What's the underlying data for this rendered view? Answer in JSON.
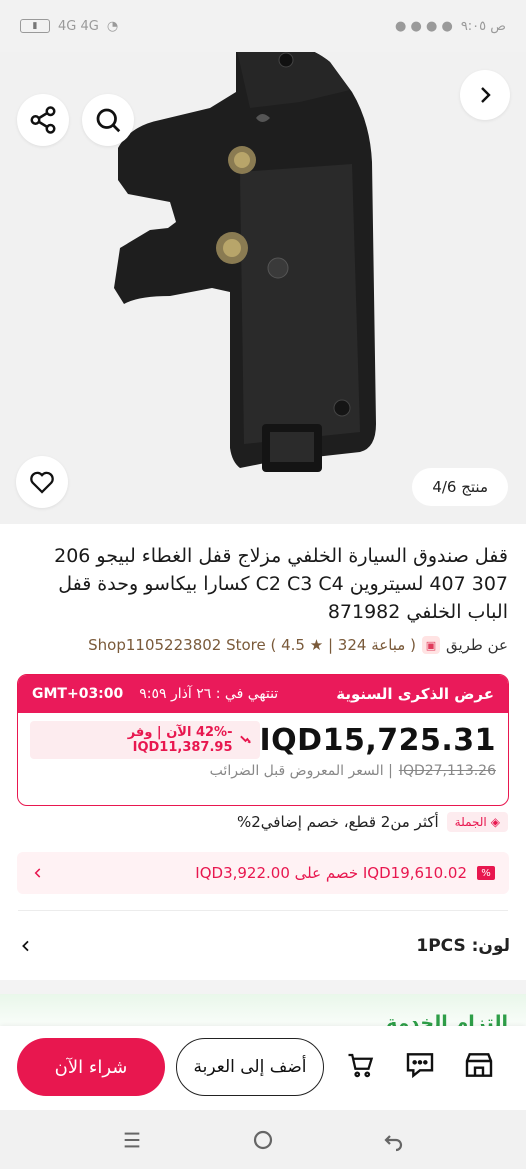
{
  "status_bar": {
    "left_text": "4G 4G",
    "right_text": "ص ٩:٠٥"
  },
  "gallery": {
    "counter_label": "منتج 4/6",
    "share_icon": "share-icon",
    "search_icon": "search-icon",
    "next_icon": "chevron-right-icon",
    "favorite_icon": "heart-icon"
  },
  "product": {
    "title": "قفل صندوق السيارة الخلفي مزلاج قفل الغطاء لبيجو 206 307 407 لسيتروين C2 C3 C4 كسارا بيكاسو وحدة قفل الباب الخلفي 871982",
    "via_label": "عن طريق",
    "store_info": "( مباعة 324 | ★ 4.5 ) Shop1105223802 Store"
  },
  "promo": {
    "title": "عرض الذكرى السنوية",
    "ends_label": "تنتهي في : ٢٦ آذار ٩:٥٩",
    "timezone": "GMT+03:00",
    "price": "IQD15,725.31",
    "discount": "-42% الآن | وفر IQD11,387.95",
    "old_price": "IQD27,113.26",
    "old_price_note": "| السعر المعروض قبل الضرائب"
  },
  "bulk": {
    "badge": "الجملة",
    "text": "أكثر من2 قطع، خصم إضافي2%"
  },
  "coupon": {
    "text": "IQD19,610.02 خصم على IQD3,922.00"
  },
  "color": {
    "label": "لون: 1PCS"
  },
  "service_peek": "التزام الخدمة",
  "actions": {
    "store_icon": "store-icon",
    "chat_icon": "chat-icon",
    "cart_icon": "cart-icon",
    "add_to_cart": "أضف إلى العربة",
    "buy_now": "شراء الآن"
  },
  "colors": {
    "accent": "#e8174f",
    "promo_header": "#ea1a5a"
  }
}
